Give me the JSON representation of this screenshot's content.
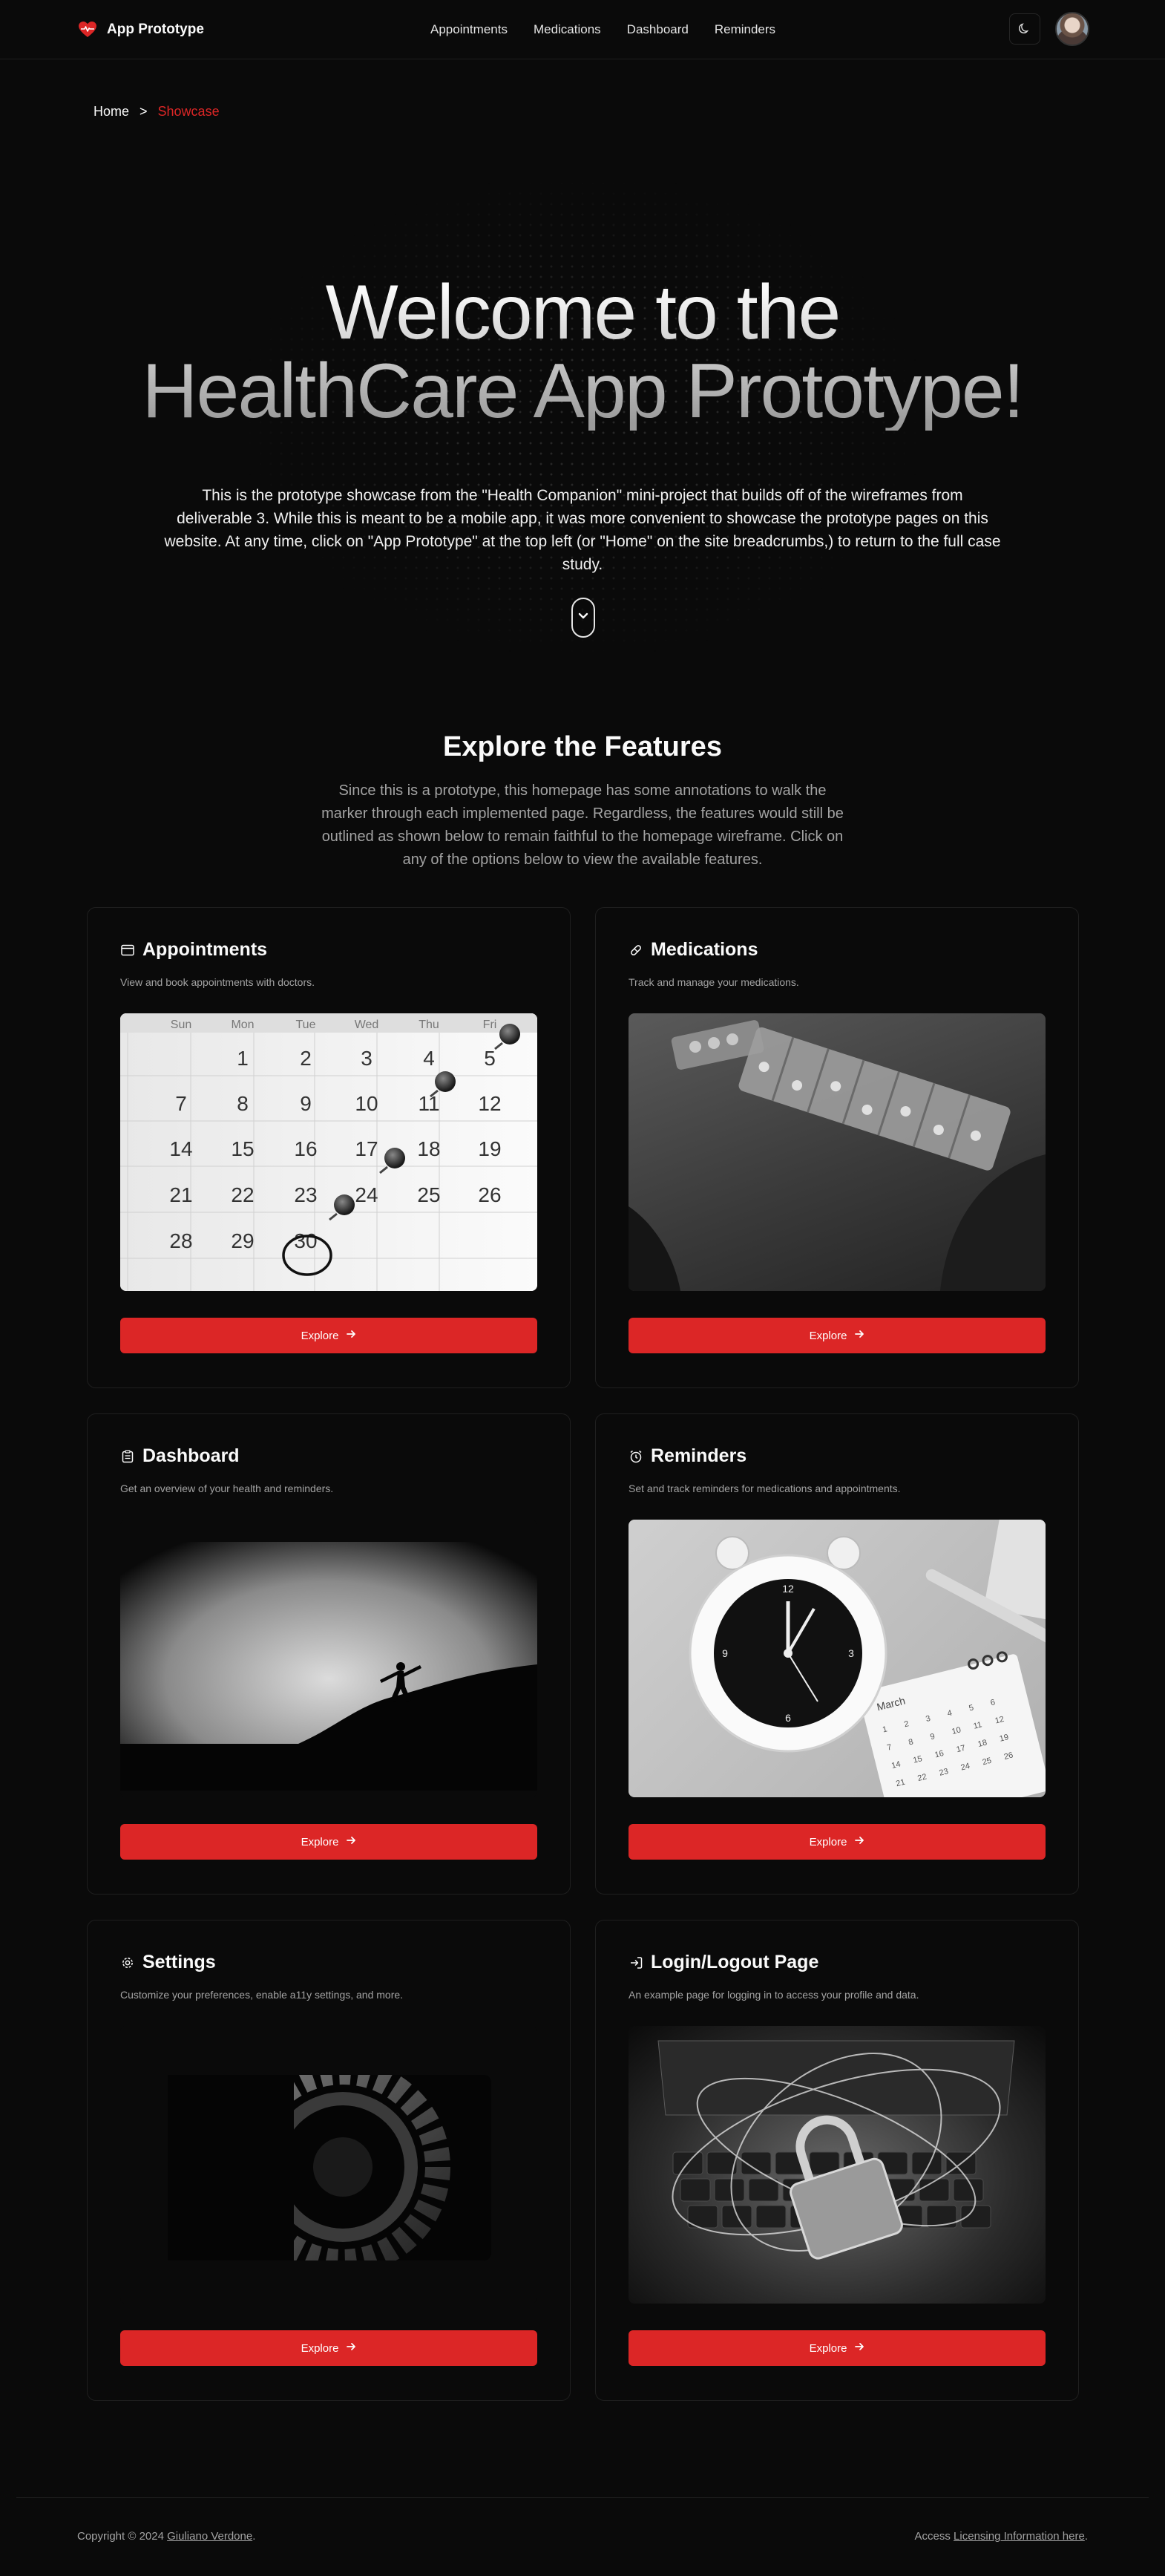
{
  "header": {
    "brand_label": "App Prototype",
    "nav": [
      "Appointments",
      "Medications",
      "Dashboard",
      "Reminders"
    ]
  },
  "breadcrumb": {
    "home": "Home",
    "separator": ">",
    "current": "Showcase"
  },
  "hero": {
    "title_line1": "Welcome to the",
    "title_line2": "HealthCare App Prototype!",
    "description": "This is the prototype showcase from the \"Health Companion\" mini-project that builds off of the wireframes from deliverable 3. While this is meant to be a mobile app, it was more convenient to showcase the prototype pages on this website. At any time, click on \"App Prototype\" at the top left (or \"Home\" on the site breadcrumbs,) to return to the full case study."
  },
  "features": {
    "title": "Explore the Features",
    "description": "Since this is a prototype, this homepage has some annotations to walk the marker through each implemented page. Regardless, the features would still be outlined as shown below to remain faithful to the homepage wireframe. Click on any of the options below to view the available features."
  },
  "cards": [
    {
      "title": "Appointments",
      "description": "View and book appointments with doctors.",
      "button": "Explore",
      "icon": "calendar-icon"
    },
    {
      "title": "Medications",
      "description": "Track and manage your medications.",
      "button": "Explore",
      "icon": "pill-icon"
    },
    {
      "title": "Dashboard",
      "description": "Get an overview of your health and reminders.",
      "button": "Explore",
      "icon": "clipboard-icon"
    },
    {
      "title": "Reminders",
      "description": "Set and track reminders for medications and appointments.",
      "button": "Explore",
      "icon": "alarm-clock-icon"
    },
    {
      "title": "Settings",
      "description": "Customize your preferences, enable a11y settings, and more.",
      "button": "Explore",
      "icon": "gear-icon"
    },
    {
      "title": "Login/Logout Page",
      "description": "An example page for logging in to access your profile and data.",
      "button": "Explore",
      "icon": "log-in-icon"
    }
  ],
  "calendar": {
    "days": [
      "Sun",
      "Mon",
      "Tue",
      "Wed",
      "Thu",
      "Fri"
    ],
    "rows": [
      [
        "",
        "1",
        "2",
        "3",
        "4",
        "5"
      ],
      [
        "7",
        "8",
        "9",
        "10",
        "11",
        "12"
      ],
      [
        "14",
        "15",
        "16",
        "17",
        "18",
        "19"
      ],
      [
        "21",
        "22",
        "23",
        "24",
        "25",
        "26"
      ],
      [
        "28",
        "29",
        "30",
        "",
        "",
        ""
      ]
    ]
  },
  "reminder_calendar_month": "March",
  "footer": {
    "copyright_prefix": "Copyright © 2024",
    "author": "Giuliano Verdone",
    "license_prefix": "Access",
    "license_link": "Licensing Information here"
  },
  "colors": {
    "accent": "#dc2626",
    "background": "#0a0a0a",
    "text": "#fafafa",
    "muted": "#a3a3a3"
  }
}
